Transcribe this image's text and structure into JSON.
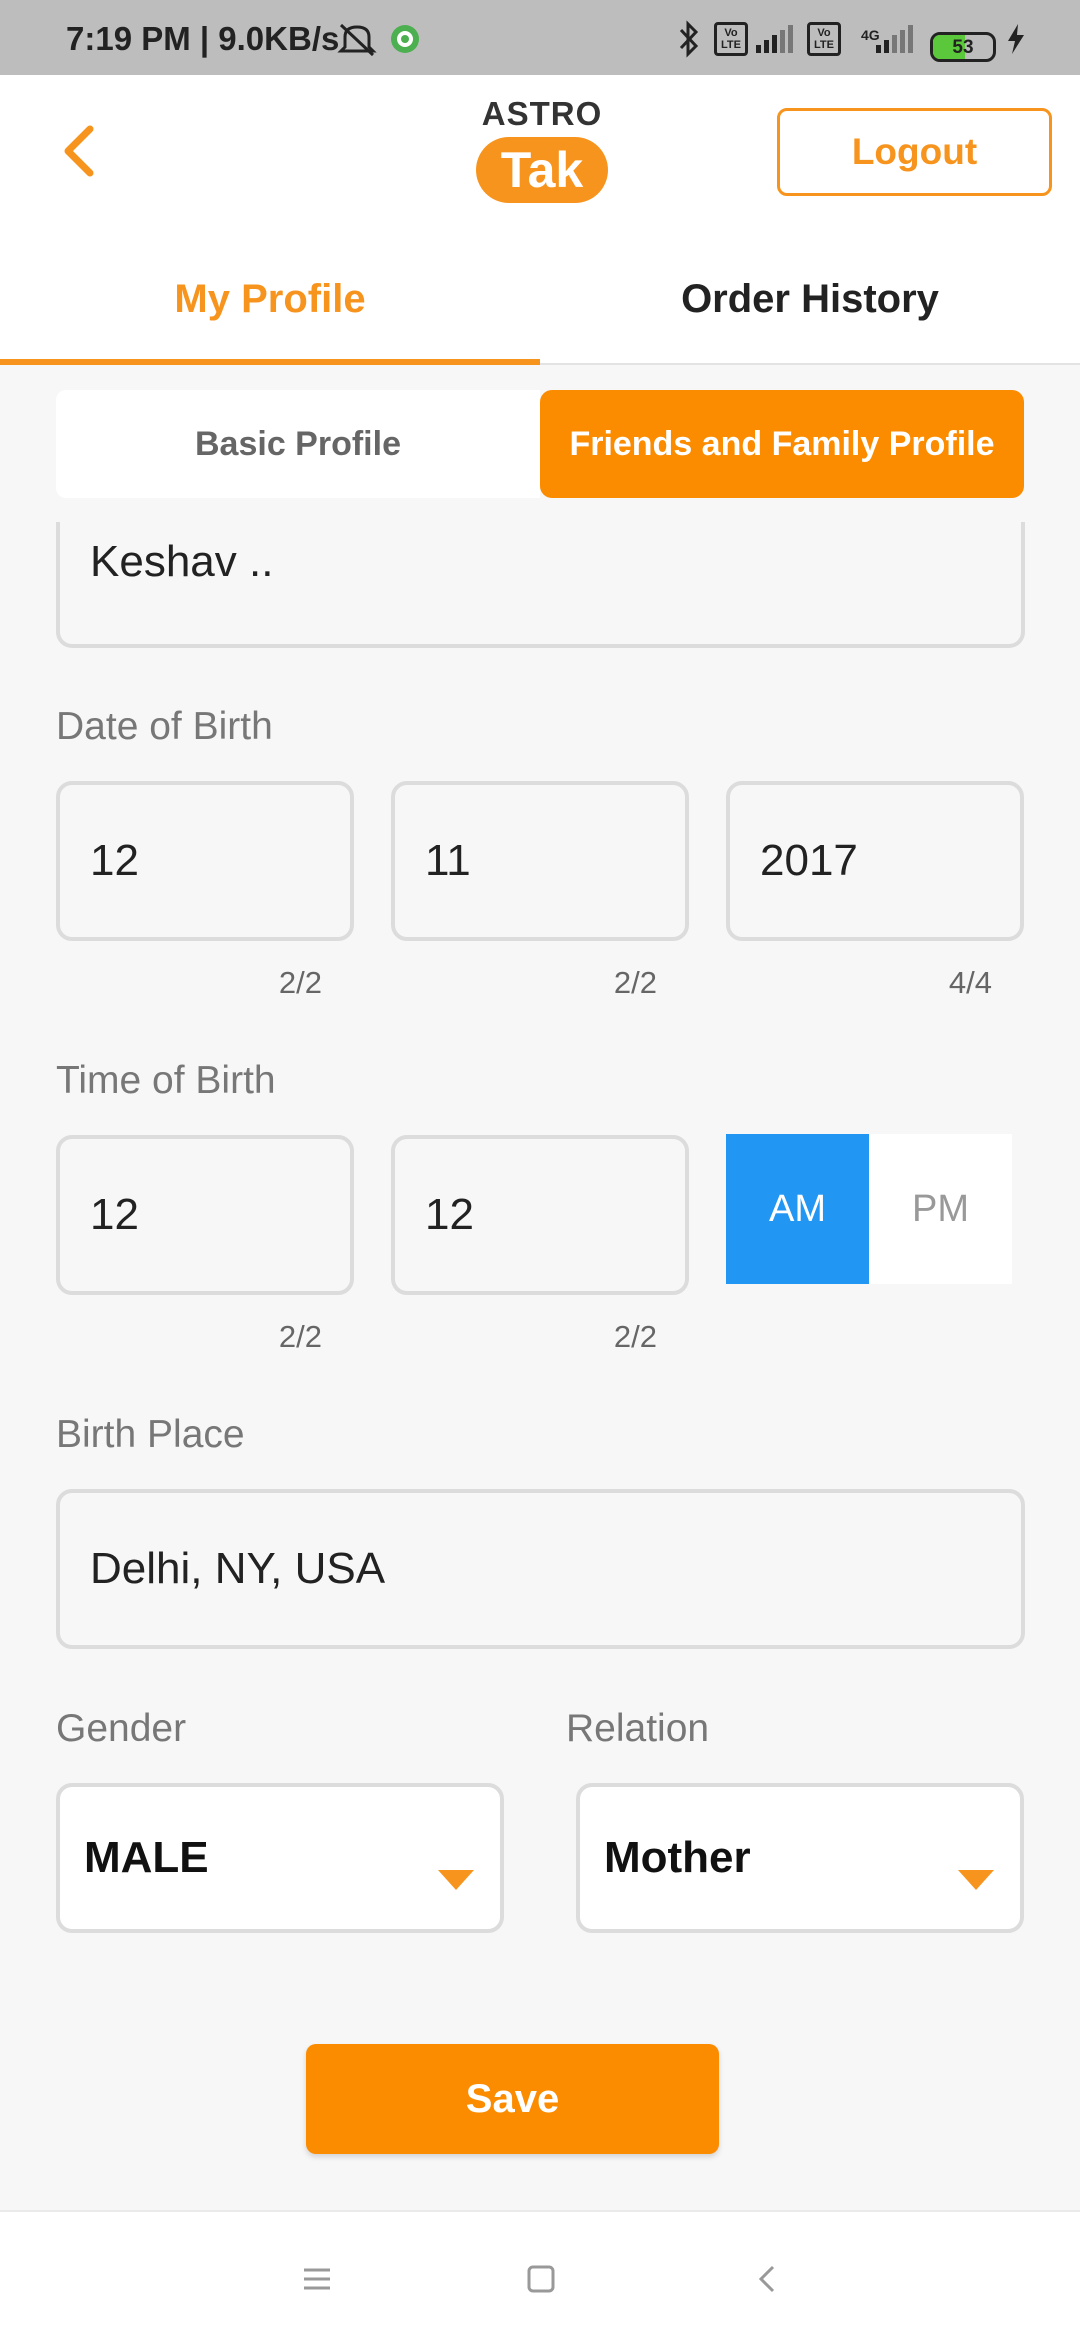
{
  "status_bar": {
    "time": "7:19 PM | 9.0KB/s",
    "volte1": "Vo LTE",
    "volte2": "Vo LTE",
    "network": "4G",
    "battery_percent": 53,
    "battery_text": "53"
  },
  "header": {
    "logo_top": "ASTRO",
    "logo_bottom": "Tak",
    "logout_label": "Logout"
  },
  "tabs": [
    {
      "label": "My Profile",
      "active": true
    },
    {
      "label": "Order History",
      "active": false
    }
  ],
  "profile_switch": {
    "basic_label": "Basic Profile",
    "family_label": "Friends and Family Profile",
    "selected": "Friends and Family Profile"
  },
  "form": {
    "name_value": "Keshav ..",
    "dob": {
      "label": "Date of Birth",
      "day": "12",
      "day_counter": "2/2",
      "month": "11",
      "month_counter": "2/2",
      "year": "2017",
      "year_counter": "4/4"
    },
    "tob": {
      "label": "Time of Birth",
      "hour": "12",
      "hour_counter": "2/2",
      "minute": "12",
      "minute_counter": "2/2",
      "am_label": "AM",
      "pm_label": "PM",
      "selected": "AM"
    },
    "birth_place": {
      "label": "Birth Place",
      "value": "Delhi, NY, USA"
    },
    "gender": {
      "label": "Gender",
      "value": "MALE"
    },
    "relation": {
      "label": "Relation",
      "value": "Mother"
    },
    "save_label": "Save"
  },
  "colors": {
    "accent": "#f7941e",
    "segment_active": "#fb8c00",
    "am_selected": "#2196f3",
    "battery": "#5ac83a"
  },
  "icons": [
    "mute-icon",
    "settings-badge-icon",
    "bluetooth-icon",
    "signal-icon",
    "battery-icon",
    "charging-icon",
    "back-arrow-icon",
    "caret-down-icon",
    "menu-icon",
    "home-icon",
    "nav-back-icon"
  ]
}
